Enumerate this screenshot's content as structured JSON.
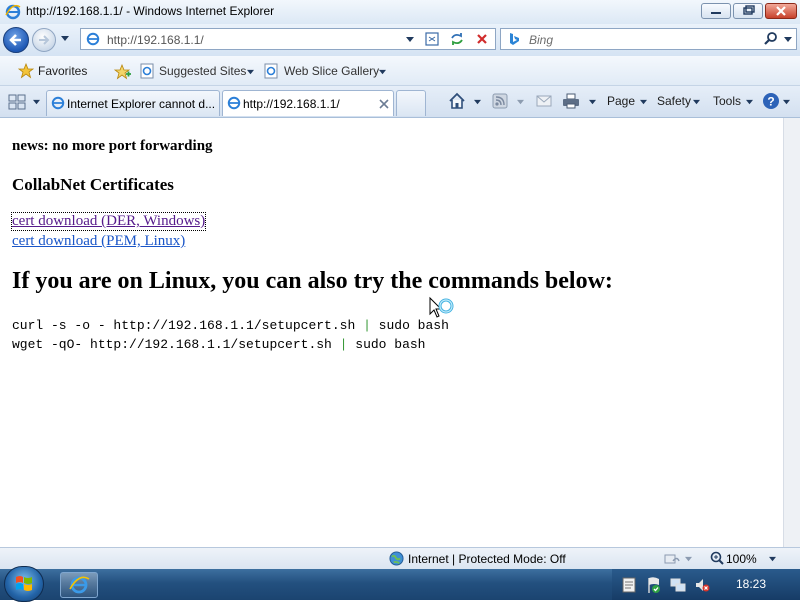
{
  "window": {
    "title": "http://192.168.1.1/ - Windows Internet Explorer",
    "colors": {
      "titlebar": "#dce8f5",
      "close_button": "#c7412b",
      "link_visited": "#551a8b",
      "link": "#1a55c8",
      "pipe": "#3a9a3a"
    }
  },
  "address_bar": {
    "url": "http://192.168.1.1/"
  },
  "search": {
    "placeholder": "Bing"
  },
  "favorites_bar": {
    "favorites_label": "Favorites",
    "suggested_sites_label": "Suggested Sites",
    "web_slice_gallery_label": "Web Slice Gallery"
  },
  "tabs": [
    {
      "label": "Internet Explorer cannot d...",
      "active": false
    },
    {
      "label": "http://192.168.1.1/",
      "active": true
    }
  ],
  "command_bar": {
    "page_label": "Page",
    "safety_label": "Safety",
    "tools_label": "Tools"
  },
  "page": {
    "news": "news: no more port forwarding",
    "section_title": "CollabNet Certificates",
    "links": [
      {
        "label": "cert download (DER, Windows)"
      },
      {
        "label": "cert download (PEM, Linux)"
      }
    ],
    "heading": "If you are on Linux, you can also try the commands below:",
    "commands": [
      {
        "cmd": "curl -s -o - http://192.168.1.1/setupcert.sh ",
        "pipe": "|",
        "rest": " sudo bash"
      },
      {
        "cmd": "wget -qO- http://192.168.1.1/setupcert.sh ",
        "pipe": "|",
        "rest": " sudo bash"
      }
    ]
  },
  "status_bar": {
    "zone": "Internet | Protected Mode: Off",
    "zoom": "100%"
  },
  "taskbar": {
    "clock": "18:23"
  }
}
